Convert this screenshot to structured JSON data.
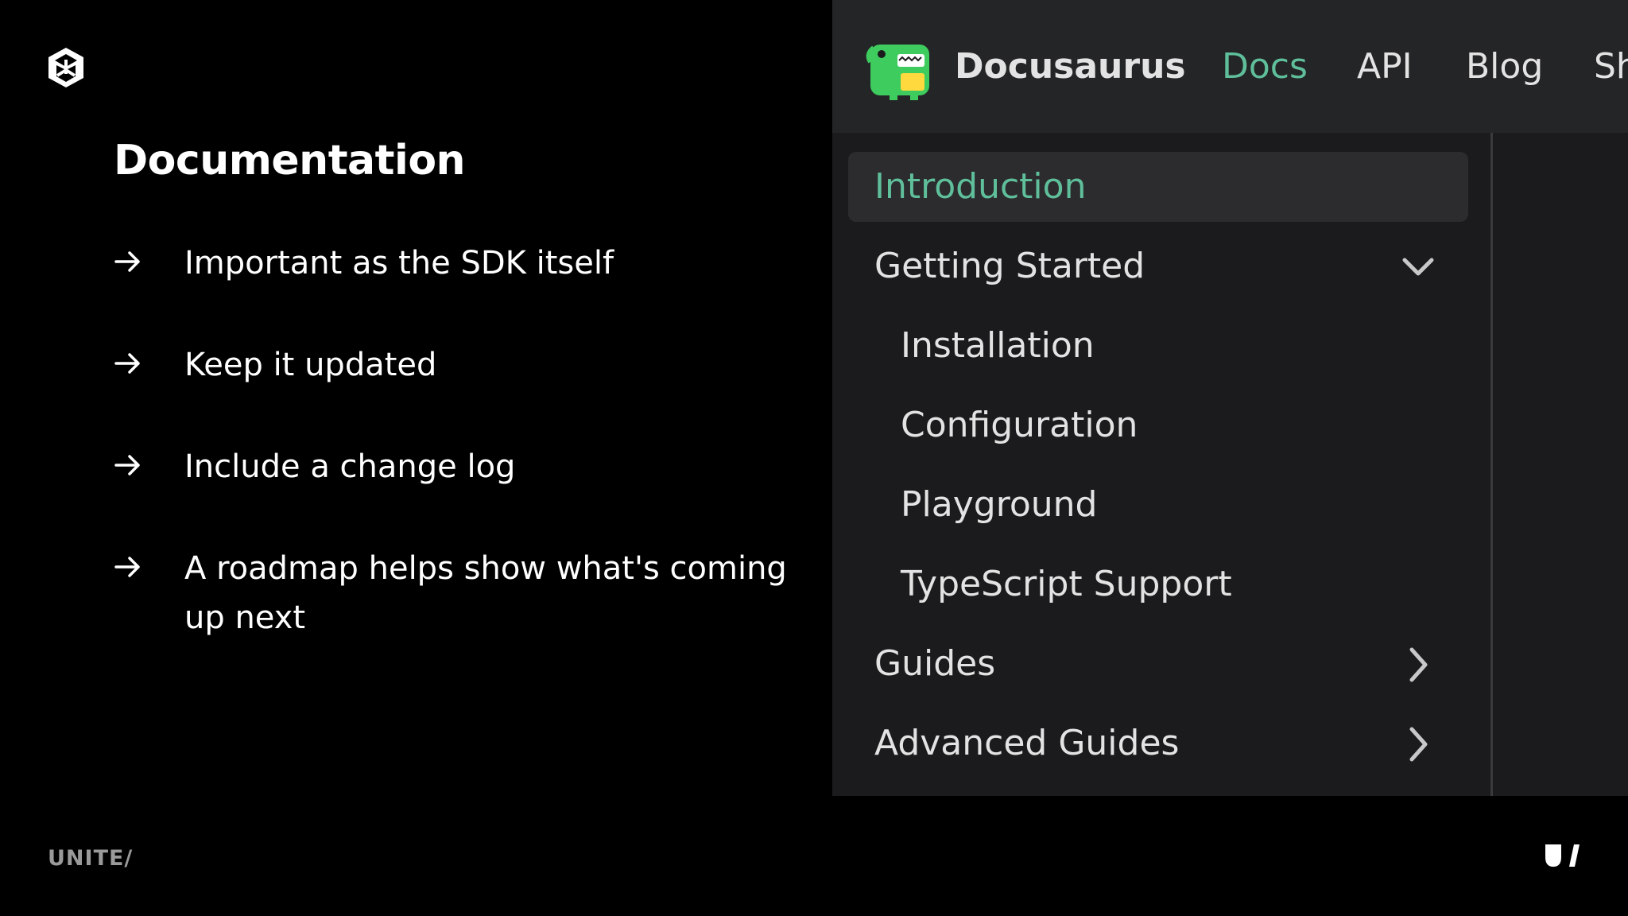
{
  "slide": {
    "title": "Documentation",
    "bullets": [
      "Important as the SDK itself",
      "Keep it updated",
      "Include a change log",
      "A roadmap helps show what's coming up next"
    ]
  },
  "docs_site": {
    "brand": "Docusaurus",
    "nav": [
      "Docs",
      "API",
      "Blog",
      "Sh"
    ],
    "active_nav": "Docs",
    "sidebar": [
      {
        "label": "Introduction",
        "active": true
      },
      {
        "label": "Getting Started",
        "caret": "chevron-down-icon"
      },
      {
        "label": "Installation"
      },
      {
        "label": "Configuration"
      },
      {
        "label": "Playground"
      },
      {
        "label": "TypeScript Support"
      },
      {
        "label": "Guides",
        "caret": "chevron-right-icon"
      },
      {
        "label": "Advanced Guides",
        "caret": "chevron-right-icon"
      }
    ],
    "colors": {
      "accent": "#5fbf9b",
      "navbar": "#242526",
      "background": "#1b1b1d"
    }
  },
  "footer": {
    "wordmark": "UNITE/"
  },
  "icons": {
    "top_left": "unity-logo-icon",
    "bullet": "arrow-right-icon",
    "bottom_right": "unite-logo-icon"
  }
}
